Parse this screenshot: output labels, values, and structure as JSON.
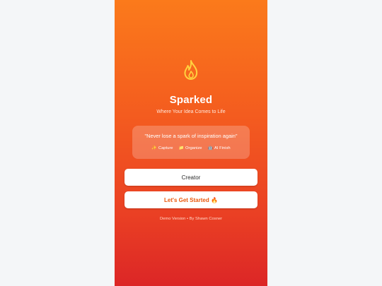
{
  "app": {
    "name": "Sparked",
    "tagline": "Where Your Idea Comes to Life",
    "logo_icon": "flame-icon"
  },
  "quote": {
    "text": "\"Never lose a spark of inspiration again\"",
    "features": [
      {
        "icon": "sparkles-icon",
        "emoji": "✨",
        "label": "Capture"
      },
      {
        "icon": "folder-icon",
        "emoji": "📁",
        "label": "Organize"
      },
      {
        "icon": "robot-icon",
        "emoji": "🤖",
        "label": "AI Finish"
      }
    ]
  },
  "creator_field": {
    "value": "Creator"
  },
  "start_button": {
    "label": "Let's Get Started 🔥"
  },
  "footer": {
    "text": "Demo Version • By Shawn Cosner"
  },
  "colors": {
    "gradient_top": "#fb7a1b",
    "gradient_bottom": "#dc2626",
    "accent_text": "#ea580c",
    "flame_outline": "#ffd23f"
  }
}
